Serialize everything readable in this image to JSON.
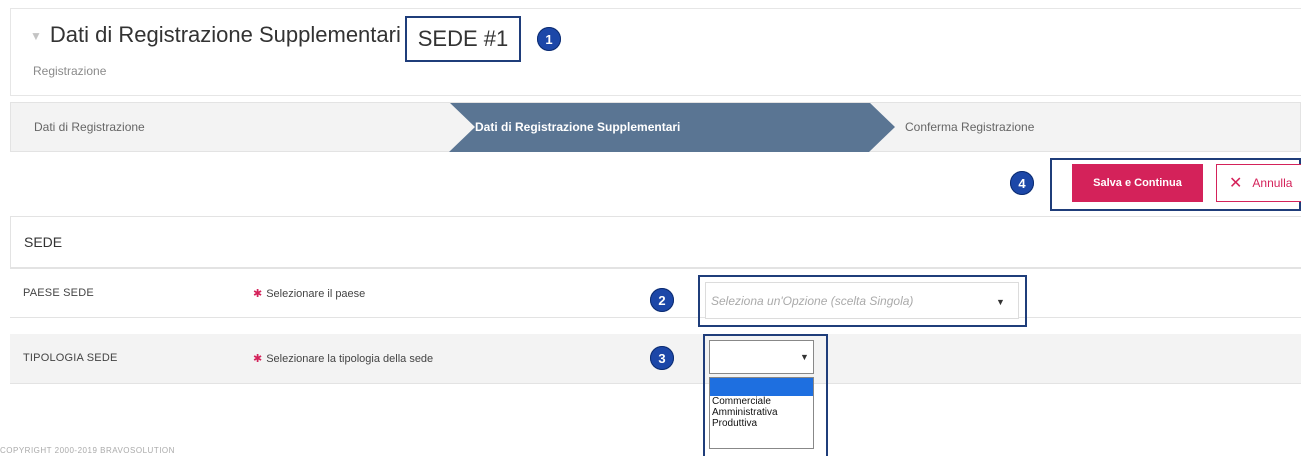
{
  "header": {
    "title": "Dati di Registrazione Supplementari",
    "sede_label": "SEDE #1",
    "breadcrumb": "Registrazione"
  },
  "annotations": {
    "n1": "1",
    "n2": "2",
    "n3": "3",
    "n4": "4"
  },
  "wizard": {
    "steps": [
      {
        "label": "Dati di Registrazione",
        "active": false
      },
      {
        "label": "Dati di Registrazione Supplementari",
        "active": true
      },
      {
        "label": "Conferma Registrazione",
        "active": false
      }
    ],
    "active_color": "#5a7593"
  },
  "actions": {
    "save_label": "Salva e Continua",
    "cancel_label": "Annulla",
    "cancel_icon": "close-icon",
    "accent_color": "#d4225a"
  },
  "section": {
    "title": "SEDE",
    "rows": [
      {
        "label": "PAESE SEDE",
        "requirement": "Selezionare il paese",
        "placeholder": "Seleziona un'Opzione (scelta Singola)"
      },
      {
        "label": "TIPOLOGIA SEDE",
        "requirement": "Selezionare la tipologia della sede",
        "selected_value": "",
        "options": [
          "",
          "Commerciale",
          "Amministrativa",
          "Produttiva"
        ]
      }
    ]
  },
  "footer": {
    "text": "COPYRIGHT 2000-2019 BRAVOSOLUTION"
  }
}
